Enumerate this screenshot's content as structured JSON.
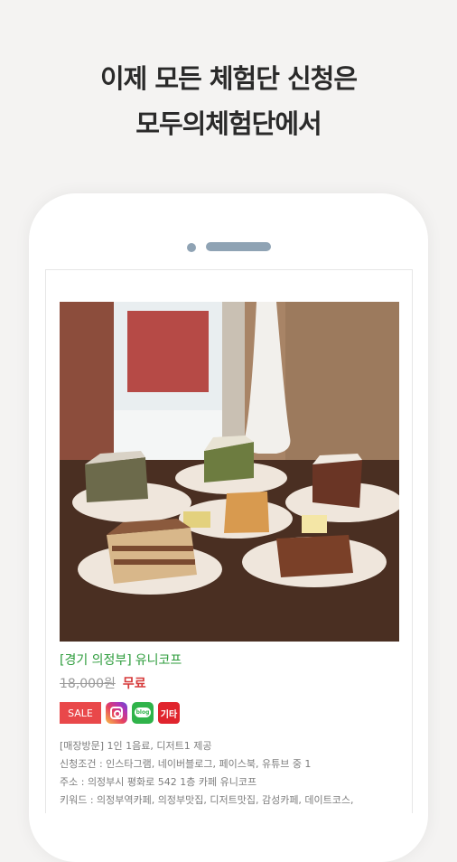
{
  "headline": {
    "line1": "이제 모든 체험단 신청은",
    "line2": "모두의체험단에서"
  },
  "listing": {
    "region": "[경기 의정부]",
    "store": "유니코프",
    "original_price": "18,000원",
    "price": "무료",
    "badges": {
      "sale": "SALE",
      "instagram_icon": "instagram-icon",
      "blog": "blog",
      "etc": "기타"
    },
    "details": [
      "[매장방문] 1인 1음료, 디저트1 제공",
      "신청조건 : 인스타그램, 네이버블로그, 페이스북, 유튜브 중 1",
      "주소 : 의정부시 평화로 542 1층 카페 유니코프",
      "키워드 : 의정부역카페, 의정부맛집, 디저트맛집, 감성카페, 데이트코스,"
    ]
  },
  "colors": {
    "background": "#f4f3f2",
    "green_title": "#2b9b3a",
    "free_red": "#d63a3a",
    "sale_red": "#e9484a"
  }
}
